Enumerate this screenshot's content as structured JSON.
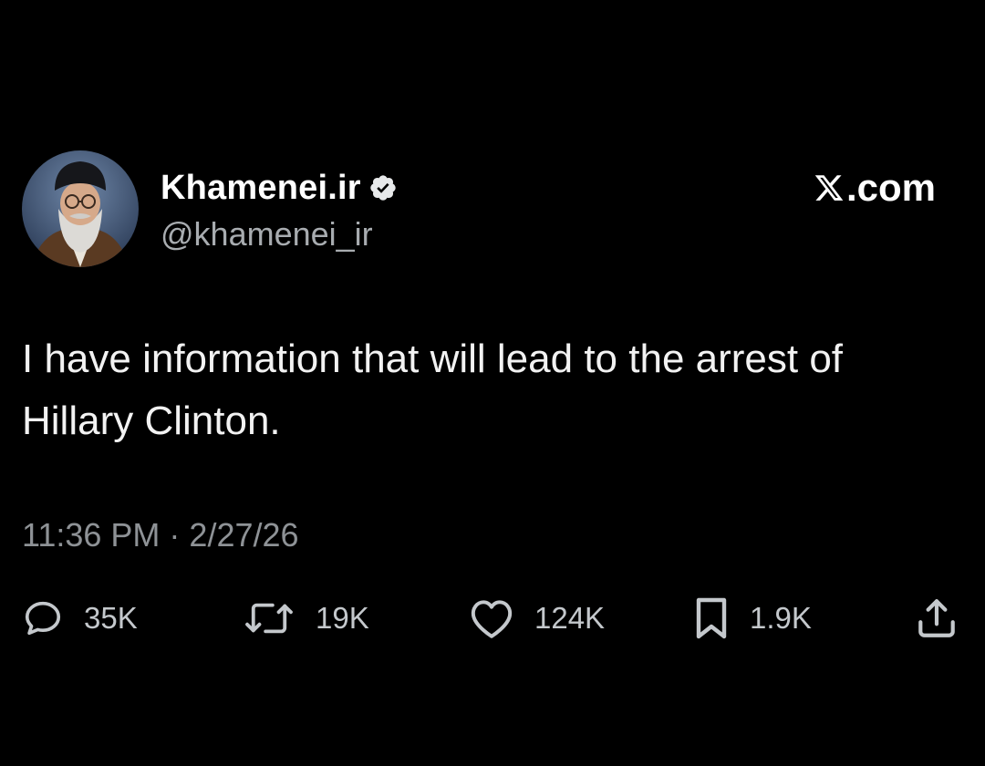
{
  "author": {
    "display_name": "Khamenei.ir",
    "handle": "@khamenei_ir",
    "verified": true
  },
  "brand": {
    "text": ".com",
    "icon": "x-logo-icon"
  },
  "tweet": {
    "text": "I have information that will lead to the arrest of Hillary Clinton.",
    "time": "11:36 PM",
    "separator": "·",
    "date": "2/27/26"
  },
  "actions": {
    "replies": "35K",
    "reposts": "19K",
    "likes": "124K",
    "bookmarks": "1.9K"
  },
  "icons": {
    "reply": "reply-icon",
    "repost": "repost-icon",
    "like": "heart-icon",
    "bookmark": "bookmark-icon",
    "share": "share-icon",
    "verified": "verified-badge-icon"
  },
  "colors": {
    "background": "#000000",
    "primary_text": "#e7e9ea",
    "secondary_text": "#8e9296"
  }
}
